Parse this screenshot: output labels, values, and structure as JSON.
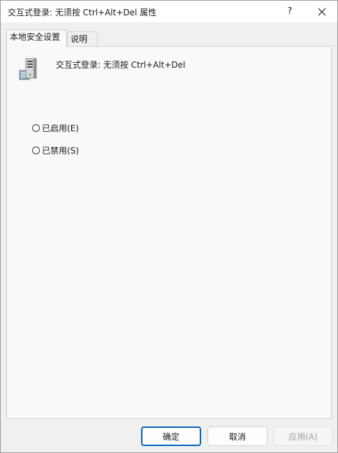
{
  "window": {
    "title": "交互式登录: 无须按 Ctrl+Alt+Del 属性",
    "help_label": "?",
    "close_label": "×"
  },
  "tabs": [
    {
      "label": "本地安全设置",
      "active": true
    },
    {
      "label": "说明",
      "active": false
    }
  ],
  "policy": {
    "icon": "server-policy-icon",
    "name": "交互式登录: 无须按 Ctrl+Alt+Del"
  },
  "options": [
    {
      "label": "已启用(E)",
      "selected": false
    },
    {
      "label": "已禁用(S)",
      "selected": false
    }
  ],
  "buttons": {
    "ok": "确定",
    "cancel": "取消",
    "apply": "应用(A)",
    "apply_enabled": false
  },
  "colors": {
    "accent": "#005fb8",
    "disabled_text": "#9d9d9d"
  }
}
